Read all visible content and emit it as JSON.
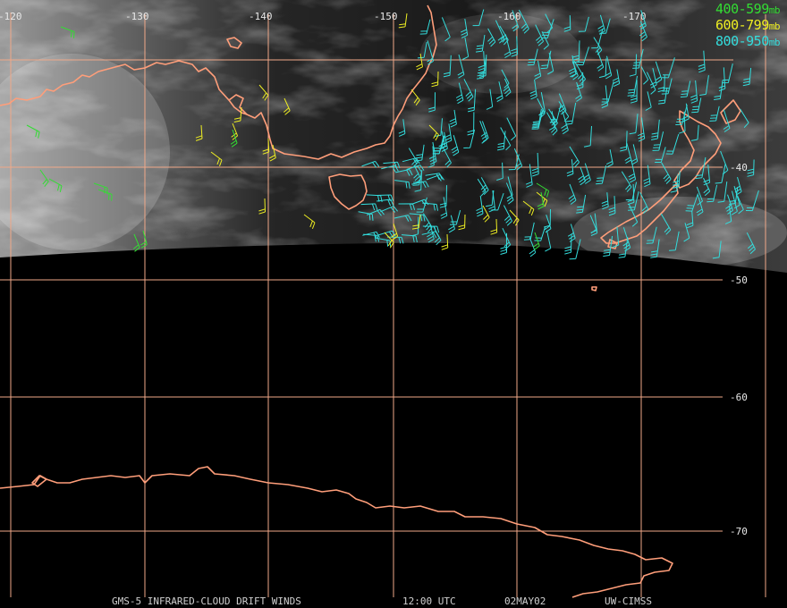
{
  "colors": {
    "background": "#000000",
    "graticule": "#f0a888",
    "coastline": "#ff9e7a",
    "band_400_599": "#33dd33",
    "band_600_799": "#eeee22",
    "band_800_950": "#33dddd"
  },
  "longitude_labels": [
    "-120",
    "-130",
    "-140",
    "-150",
    "-160",
    "-170"
  ],
  "latitude_labels": [
    "-40",
    "-50",
    "-60",
    "-70"
  ],
  "legend": [
    {
      "label": "400-599",
      "unit": "mb",
      "color": "#33dd33"
    },
    {
      "label": "600-799",
      "unit": "mb",
      "color": "#eeee22"
    },
    {
      "label": "800-950",
      "unit": "mb",
      "color": "#33dddd"
    }
  ],
  "footer": {
    "product": "GMS-5 INFRARED-CLOUD DRIFT WINDS",
    "time": "12:00 UTC",
    "date": "02MAY02",
    "source": "UW-CIMSS"
  }
}
